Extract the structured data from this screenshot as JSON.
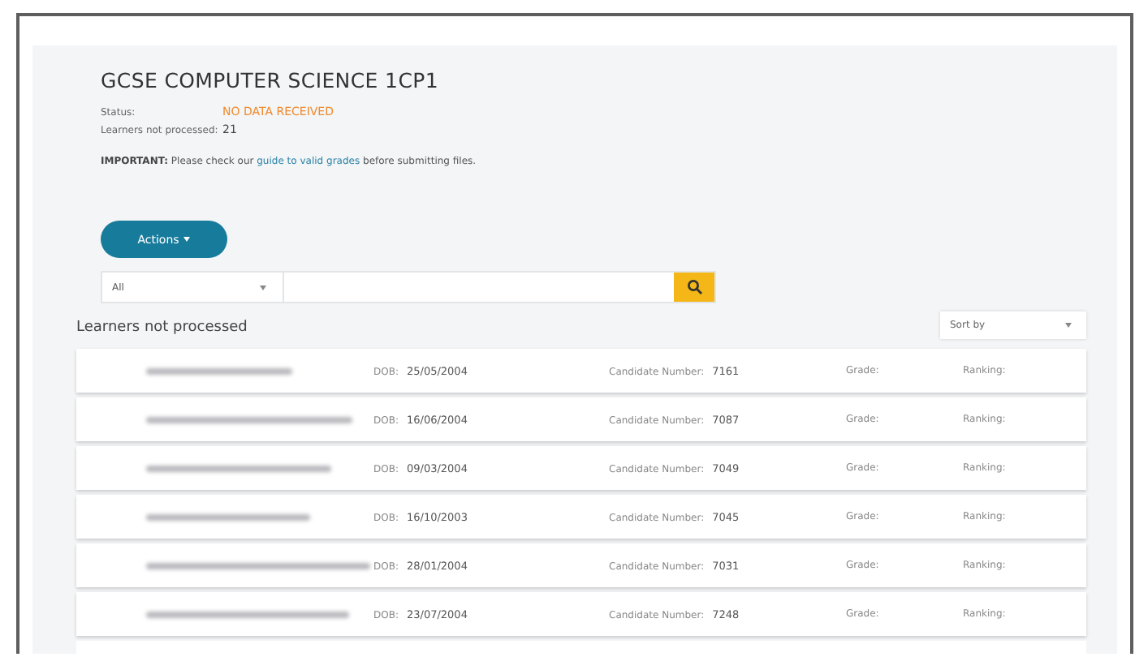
{
  "title": "GCSE COMPUTER SCIENCE 1CP1",
  "status": {
    "label": "Status:",
    "value": "NO DATA RECEIVED"
  },
  "learners_count": {
    "label": "Learners not processed:",
    "value": "21"
  },
  "notice": {
    "lead": "IMPORTANT:",
    "before": "Please check our",
    "link": "guide to valid grades",
    "after": "before submitting files."
  },
  "actions_button": {
    "label": "Actions"
  },
  "filter": {
    "select_value": "All"
  },
  "section_title": "Learners not processed",
  "sort": {
    "label": "Sort by"
  },
  "rows": [
    {
      "dob_label": "DOB:",
      "dob": "25/05/2004",
      "candidate_label": "Candidate Number:",
      "candidate": "7161",
      "grade_label": "Grade:",
      "ranking_label": "Ranking:"
    },
    {
      "dob_label": "DOB:",
      "dob": "16/06/2004",
      "candidate_label": "Candidate Number:",
      "candidate": "7087",
      "grade_label": "Grade:",
      "ranking_label": "Ranking:"
    },
    {
      "dob_label": "DOB:",
      "dob": "09/03/2004",
      "candidate_label": "Candidate Number:",
      "candidate": "7049",
      "grade_label": "Grade:",
      "ranking_label": "Ranking:"
    },
    {
      "dob_label": "DOB:",
      "dob": "16/10/2003",
      "candidate_label": "Candidate Number:",
      "candidate": "7045",
      "grade_label": "Grade:",
      "ranking_label": "Ranking:"
    },
    {
      "dob_label": "DOB:",
      "dob": "28/01/2004",
      "candidate_label": "Candidate Number:",
      "candidate": "7031",
      "grade_label": "Grade:",
      "ranking_label": "Ranking:"
    },
    {
      "dob_label": "DOB:",
      "dob": "23/07/2004",
      "candidate_label": "Candidate Number:",
      "candidate": "7248",
      "grade_label": "Grade:",
      "ranking_label": "Ranking:"
    }
  ]
}
